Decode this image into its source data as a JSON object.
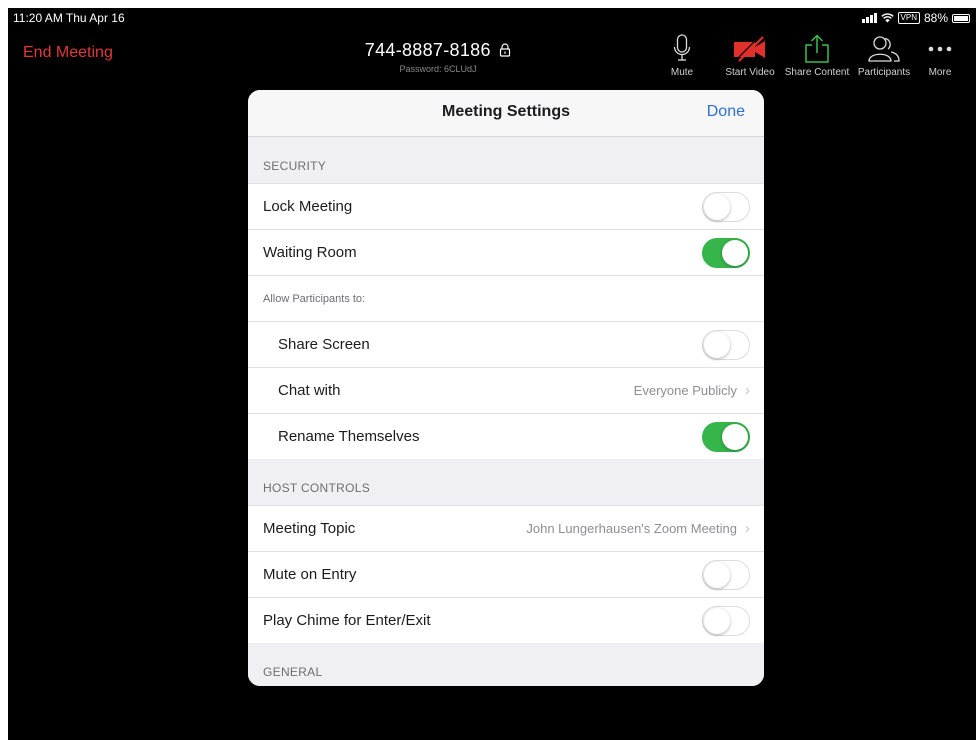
{
  "status_bar": {
    "time": "11:20 AM  Thu Apr 16",
    "vpn": "VPN",
    "battery": "88%"
  },
  "toolbar": {
    "end_meeting": "End Meeting",
    "meeting_id": "744-8887-8186",
    "password": "Password: 6CLUdJ",
    "mute": "Mute",
    "start_video": "Start Video",
    "share_content": "Share Content",
    "participants": "Participants",
    "more": "More"
  },
  "panel": {
    "title": "Meeting Settings",
    "done": "Done",
    "security": {
      "header": "SECURITY",
      "lock_meeting": {
        "label": "Lock Meeting",
        "on": false
      },
      "waiting_room": {
        "label": "Waiting Room",
        "on": true
      },
      "allow_header": "Allow Participants to:",
      "share_screen": {
        "label": "Share Screen",
        "on": false
      },
      "chat_with": {
        "label": "Chat with",
        "value": "Everyone Publicly"
      },
      "rename": {
        "label": "Rename Themselves",
        "on": true
      }
    },
    "host_controls": {
      "header": "HOST CONTROLS",
      "meeting_topic": {
        "label": "Meeting Topic",
        "value": "John Lungerhausen's Zoom Meeting"
      },
      "mute_on_entry": {
        "label": "Mute on Entry",
        "on": false
      },
      "play_chime": {
        "label": "Play Chime for Enter/Exit",
        "on": false
      }
    },
    "general": {
      "header": "GENERAL"
    }
  },
  "colors": {
    "end_meeting": "#e03a36",
    "toggle_on": "#35b54a",
    "done": "#2d6fd2",
    "video_off": "#e0302c",
    "share": "#3bbf4c"
  }
}
